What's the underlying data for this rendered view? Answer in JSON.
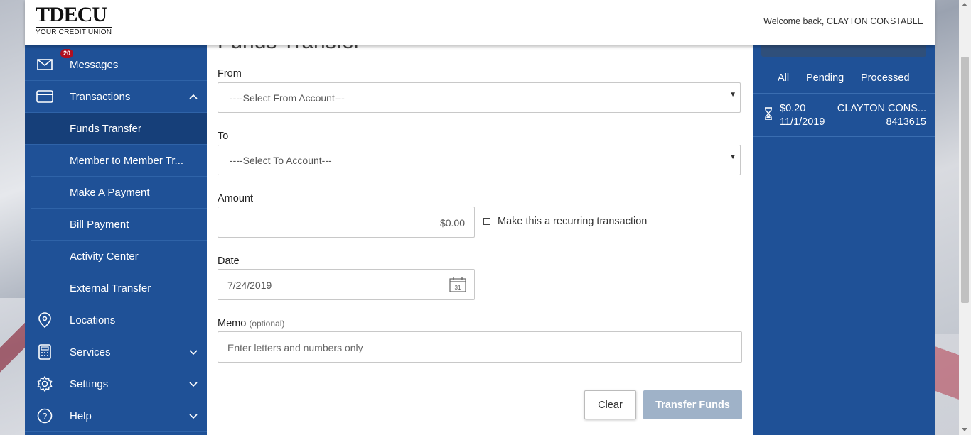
{
  "header": {
    "logo_main": "TDECU",
    "logo_sub": "YOUR CREDIT UNION",
    "welcome": "Welcome back, CLAYTON CONSTABLE"
  },
  "sidebar": {
    "messages": {
      "label": "Messages",
      "badge": "20",
      "icon": "envelope-icon"
    },
    "transactions": {
      "label": "Transactions",
      "icon": "card-icon"
    },
    "sub_items": [
      {
        "label": "Funds Transfer",
        "active": true
      },
      {
        "label": "Member to Member Tr..."
      },
      {
        "label": "Make A Payment"
      },
      {
        "label": "Bill Payment"
      },
      {
        "label": "Activity Center"
      },
      {
        "label": "External Transfer"
      }
    ],
    "locations": {
      "label": "Locations",
      "icon": "location-pin-icon"
    },
    "services": {
      "label": "Services",
      "icon": "calculator-icon"
    },
    "settings": {
      "label": "Settings",
      "icon": "gear-icon"
    },
    "help": {
      "label": "Help",
      "icon": "question-icon"
    }
  },
  "form": {
    "title": "Funds Transfer",
    "from_label": "From",
    "from_value": "----Select From Account---",
    "to_label": "To",
    "to_value": "----Select To Account---",
    "amount_label": "Amount",
    "amount_value": "$0.00",
    "recurring_label": "Make this a recurring transaction",
    "date_label": "Date",
    "date_value": "7/24/2019",
    "calendar_day": "31",
    "memo_label": "Memo",
    "memo_optional": "(optional)",
    "memo_placeholder": "Enter letters and numbers only",
    "clear_label": "Clear",
    "transfer_label": "Transfer Funds"
  },
  "right_panel": {
    "tabs": [
      "All",
      "Pending",
      "Processed"
    ],
    "transactions": [
      {
        "amount": "$0.20",
        "date": "11/1/2019",
        "name": "CLAYTON CONS...",
        "account": "8413615",
        "status_icon": "hourglass-icon"
      }
    ]
  },
  "colors": {
    "nav_blue": "#1f5197",
    "active_blue": "#163f79",
    "badge_red": "#b01020",
    "disabled_button": "#9fb2c8"
  }
}
